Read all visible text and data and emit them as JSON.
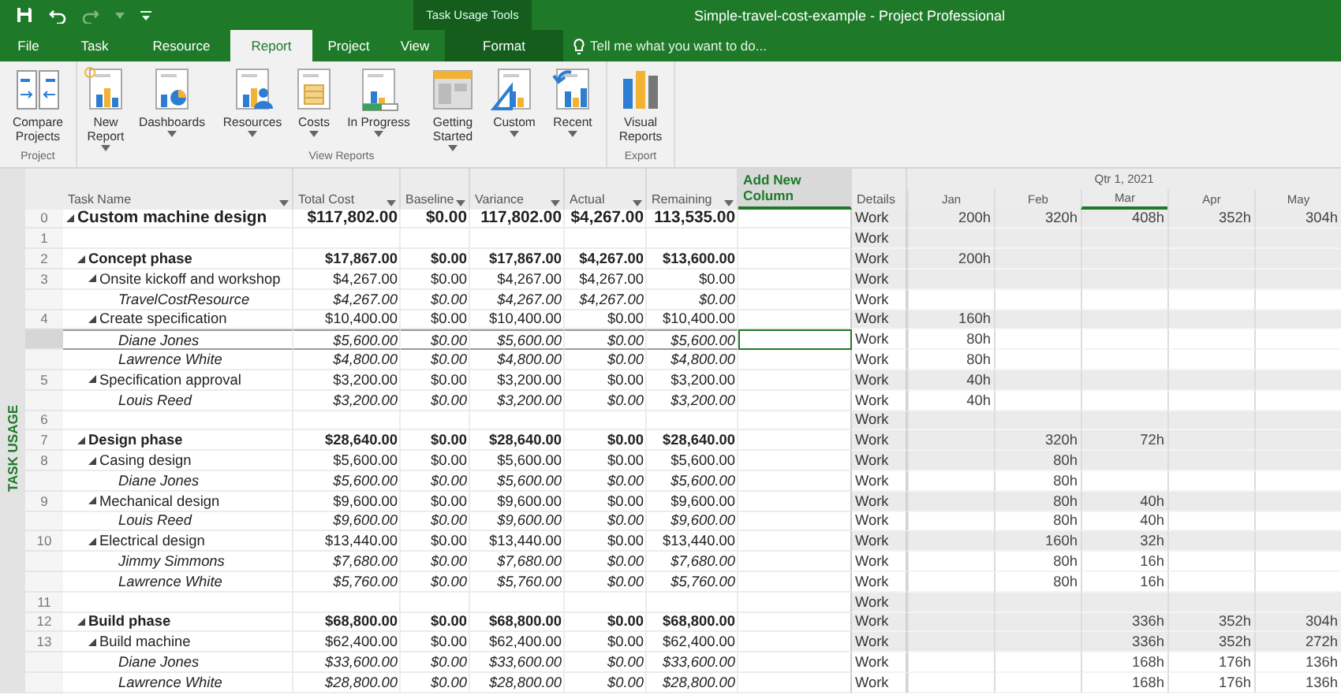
{
  "title_bar": {
    "title": "Simple-travel-cost-example - Project Professional",
    "context_header": "Task Usage Tools"
  },
  "tabs": [
    {
      "label": "File",
      "kind": "normal",
      "selected": false
    },
    {
      "label": "Task",
      "kind": "normal",
      "selected": false
    },
    {
      "label": "Resource",
      "kind": "normal",
      "selected": false
    },
    {
      "label": "Report",
      "kind": "normal",
      "selected": true
    },
    {
      "label": "Project",
      "kind": "normal",
      "selected": false
    },
    {
      "label": "View",
      "kind": "normal",
      "selected": false
    },
    {
      "label": "Format",
      "kind": "contextual",
      "selected": false
    }
  ],
  "tell_me": {
    "placeholder": "Tell me what you want to do..."
  },
  "ribbon": [
    {
      "label": "Project",
      "buttons": [
        {
          "label": "Compare Projects",
          "dropdown": false
        }
      ]
    },
    {
      "label": "View Reports",
      "buttons": [
        {
          "label": "New Report",
          "dropdown": true
        },
        {
          "label": "Dashboards",
          "dropdown": true
        },
        {
          "label": "Resources",
          "dropdown": true
        },
        {
          "label": "Costs",
          "dropdown": true
        },
        {
          "label": "In Progress",
          "dropdown": true
        },
        {
          "label": "Getting Started",
          "dropdown": true
        },
        {
          "label": "Custom",
          "dropdown": true
        },
        {
          "label": "Recent",
          "dropdown": true
        }
      ]
    },
    {
      "label": "Export",
      "buttons": [
        {
          "label": "Visual Reports",
          "dropdown": false
        }
      ]
    }
  ],
  "side_label": "TASK USAGE",
  "columns": [
    {
      "label": "Task Name",
      "kind": "field"
    },
    {
      "label": "Total Cost",
      "kind": "field"
    },
    {
      "label": "Baseline",
      "kind": "field"
    },
    {
      "label": "Variance",
      "kind": "field"
    },
    {
      "label": "Actual",
      "kind": "field"
    },
    {
      "label": "Remaining",
      "kind": "field"
    },
    {
      "label": "Add New Column",
      "kind": "add"
    }
  ],
  "details_header": "Details",
  "timescale": {
    "quarter": "Qtr 1, 2021",
    "months": [
      {
        "label": "Jan",
        "current": false
      },
      {
        "label": "Feb",
        "current": false
      },
      {
        "label": "Mar",
        "current": true
      },
      {
        "label": "Apr",
        "current": false
      },
      {
        "label": "May",
        "current": false
      }
    ]
  },
  "rows": [
    {
      "id": "0",
      "name": "Custom machine design",
      "kind": "project",
      "expanded": true,
      "selected": false,
      "costs": [
        "$117,802.00",
        "$0.00",
        "117,802.00",
        "$4,267.00",
        "113,535.00"
      ],
      "detail": "Work",
      "work": {
        "jan": "200h",
        "feb": "320h",
        "mar": "408h",
        "apr": "352h",
        "may": "304h"
      },
      "children": [
        {
          "id": "1",
          "kind": "blank",
          "selected": false,
          "detail": "Work"
        },
        {
          "id": "2",
          "name": "Concept phase",
          "kind": "summary",
          "expanded": true,
          "selected": false,
          "costs": [
            "$17,867.00",
            "$0.00",
            "$17,867.00",
            "$4,267.00",
            "$13,600.00"
          ],
          "detail": "Work",
          "work": {
            "jan": "200h"
          },
          "children": [
            {
              "id": "3",
              "name": "Onsite kickoff and workshop",
              "kind": "task",
              "expanded": true,
              "selected": false,
              "costs": [
                "$4,267.00",
                "$0.00",
                "$4,267.00",
                "$4,267.00",
                "$0.00"
              ],
              "detail": "Work",
              "children": [
                {
                  "name": "TravelCostResource",
                  "kind": "assignment",
                  "selected": false,
                  "costs": [
                    "$4,267.00",
                    "$0.00",
                    "$4,267.00",
                    "$4,267.00",
                    "$0.00"
                  ],
                  "detail": "Work"
                }
              ]
            },
            {
              "id": "4",
              "name": "Create specification",
              "kind": "task",
              "expanded": true,
              "selected": false,
              "costs": [
                "$10,400.00",
                "$0.00",
                "$10,400.00",
                "$0.00",
                "$10,400.00"
              ],
              "detail": "Work",
              "work": {
                "jan": "160h"
              },
              "children": [
                {
                  "name": "Diane Jones",
                  "kind": "assignment",
                  "selected": true,
                  "costs": [
                    "$5,600.00",
                    "$0.00",
                    "$5,600.00",
                    "$0.00",
                    "$5,600.00"
                  ],
                  "detail": "Work",
                  "work": {
                    "jan": "80h"
                  }
                },
                {
                  "name": "Lawrence White",
                  "kind": "assignment",
                  "selected": false,
                  "costs": [
                    "$4,800.00",
                    "$0.00",
                    "$4,800.00",
                    "$0.00",
                    "$4,800.00"
                  ],
                  "detail": "Work",
                  "work": {
                    "jan": "80h"
                  }
                }
              ]
            },
            {
              "id": "5",
              "name": "Specification approval",
              "kind": "task",
              "expanded": true,
              "selected": false,
              "costs": [
                "$3,200.00",
                "$0.00",
                "$3,200.00",
                "$0.00",
                "$3,200.00"
              ],
              "detail": "Work",
              "work": {
                "jan": "40h"
              },
              "children": [
                {
                  "name": "Louis Reed",
                  "kind": "assignment",
                  "selected": false,
                  "costs": [
                    "$3,200.00",
                    "$0.00",
                    "$3,200.00",
                    "$0.00",
                    "$3,200.00"
                  ],
                  "detail": "Work",
                  "work": {
                    "jan": "40h"
                  }
                }
              ]
            }
          ]
        },
        {
          "id": "6",
          "kind": "blank",
          "selected": false,
          "detail": "Work"
        },
        {
          "id": "7",
          "name": "Design phase",
          "kind": "summary",
          "expanded": true,
          "selected": false,
          "costs": [
            "$28,640.00",
            "$0.00",
            "$28,640.00",
            "$0.00",
            "$28,640.00"
          ],
          "detail": "Work",
          "work": {
            "feb": "320h",
            "mar": "72h"
          },
          "children": [
            {
              "id": "8",
              "name": "Casing design",
              "kind": "task",
              "expanded": true,
              "selected": false,
              "costs": [
                "$5,600.00",
                "$0.00",
                "$5,600.00",
                "$0.00",
                "$5,600.00"
              ],
              "detail": "Work",
              "work": {
                "feb": "80h"
              },
              "children": [
                {
                  "name": "Diane Jones",
                  "kind": "assignment",
                  "selected": false,
                  "costs": [
                    "$5,600.00",
                    "$0.00",
                    "$5,600.00",
                    "$0.00",
                    "$5,600.00"
                  ],
                  "detail": "Work",
                  "work": {
                    "feb": "80h"
                  }
                }
              ]
            },
            {
              "id": "9",
              "name": "Mechanical design",
              "kind": "task",
              "expanded": true,
              "selected": false,
              "costs": [
                "$9,600.00",
                "$0.00",
                "$9,600.00",
                "$0.00",
                "$9,600.00"
              ],
              "detail": "Work",
              "work": {
                "feb": "80h",
                "mar": "40h"
              },
              "children": [
                {
                  "name": "Louis Reed",
                  "kind": "assignment",
                  "selected": false,
                  "costs": [
                    "$9,600.00",
                    "$0.00",
                    "$9,600.00",
                    "$0.00",
                    "$9,600.00"
                  ],
                  "detail": "Work",
                  "work": {
                    "feb": "80h",
                    "mar": "40h"
                  }
                }
              ]
            },
            {
              "id": "10",
              "name": "Electrical design",
              "kind": "task",
              "expanded": true,
              "selected": false,
              "costs": [
                "$13,440.00",
                "$0.00",
                "$13,440.00",
                "$0.00",
                "$13,440.00"
              ],
              "detail": "Work",
              "work": {
                "feb": "160h",
                "mar": "32h"
              },
              "children": [
                {
                  "name": "Jimmy Simmons",
                  "kind": "assignment",
                  "selected": false,
                  "costs": [
                    "$7,680.00",
                    "$0.00",
                    "$7,680.00",
                    "$0.00",
                    "$7,680.00"
                  ],
                  "detail": "Work",
                  "work": {
                    "feb": "80h",
                    "mar": "16h"
                  }
                },
                {
                  "name": "Lawrence White",
                  "kind": "assignment",
                  "selected": false,
                  "costs": [
                    "$5,760.00",
                    "$0.00",
                    "$5,760.00",
                    "$0.00",
                    "$5,760.00"
                  ],
                  "detail": "Work",
                  "work": {
                    "feb": "80h",
                    "mar": "16h"
                  }
                }
              ]
            }
          ]
        },
        {
          "id": "11",
          "kind": "blank",
          "selected": false,
          "detail": "Work"
        },
        {
          "id": "12",
          "name": "Build phase",
          "kind": "summary",
          "expanded": true,
          "selected": false,
          "costs": [
            "$68,800.00",
            "$0.00",
            "$68,800.00",
            "$0.00",
            "$68,800.00"
          ],
          "detail": "Work",
          "work": {
            "mar": "336h",
            "apr": "352h",
            "may": "304h"
          },
          "children": [
            {
              "id": "13",
              "name": "Build machine",
              "kind": "task",
              "expanded": true,
              "selected": false,
              "costs": [
                "$62,400.00",
                "$0.00",
                "$62,400.00",
                "$0.00",
                "$62,400.00"
              ],
              "detail": "Work",
              "work": {
                "mar": "336h",
                "apr": "352h",
                "may": "272h"
              },
              "children": [
                {
                  "name": "Diane Jones",
                  "kind": "assignment",
                  "selected": false,
                  "costs": [
                    "$33,600.00",
                    "$0.00",
                    "$33,600.00",
                    "$0.00",
                    "$33,600.00"
                  ],
                  "detail": "Work",
                  "work": {
                    "mar": "168h",
                    "apr": "176h",
                    "may": "136h"
                  }
                },
                {
                  "name": "Lawrence White",
                  "kind": "assignment",
                  "selected": false,
                  "costs": [
                    "$28,800.00",
                    "$0.00",
                    "$28,800.00",
                    "$0.00",
                    "$28,800.00"
                  ],
                  "detail": "Work",
                  "work": {
                    "mar": "168h",
                    "apr": "176h",
                    "may": "136h"
                  }
                }
              ]
            }
          ]
        }
      ]
    }
  ]
}
